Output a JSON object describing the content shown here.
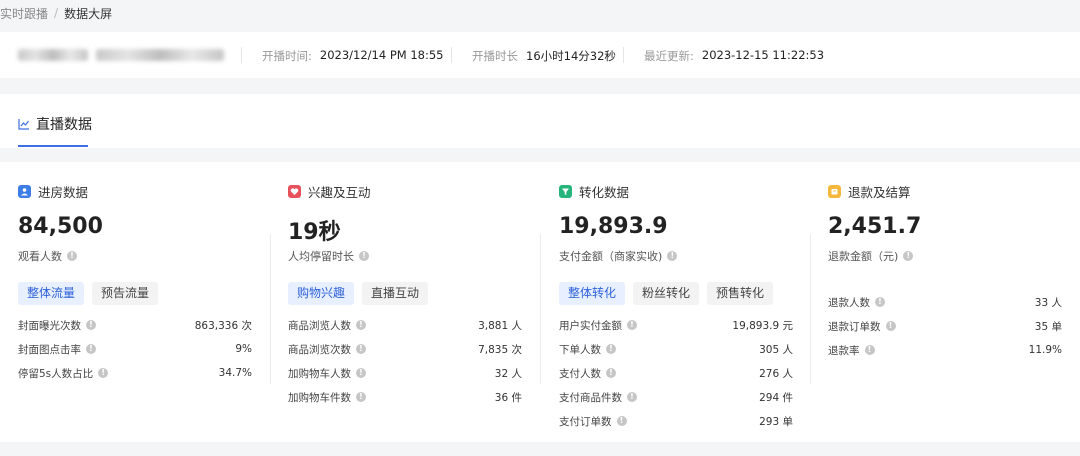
{
  "breadcrumb": {
    "parent": "实时跟播",
    "separator": "/",
    "current": "数据大屏"
  },
  "info": {
    "start_time_label": "开播时间:",
    "start_time_value": "2023/12/14 PM 18:55",
    "duration_label": "开播时长",
    "duration_value": "16小时14分32秒",
    "updated_label": "最近更新:",
    "updated_value": "2023-12-15 11:22:53"
  },
  "tab": {
    "label": "直播数据",
    "icon": "line-chart-icon"
  },
  "columns": [
    {
      "title": "进房数据",
      "icon": "user-icon",
      "icon_color": "#3c7de6",
      "metric_value": "84,500",
      "metric_label": "观看人数",
      "pills": [
        "整体流量",
        "预告流量"
      ],
      "rows": [
        {
          "label": "封面曝光次数",
          "value": "863,336 次"
        },
        {
          "label": "封面图点击率",
          "value": "9%"
        },
        {
          "label": "停留5s人数占比",
          "value": "34.7%"
        }
      ]
    },
    {
      "title": "兴趣及互动",
      "icon": "heart-icon",
      "icon_color": "#e8505b",
      "metric_value": "19秒",
      "metric_label": "人均停留时长",
      "pills": [
        "购物兴趣",
        "直播互动"
      ],
      "rows": [
        {
          "label": "商品浏览人数",
          "value": "3,881 人"
        },
        {
          "label": "商品浏览次数",
          "value": "7,835 次"
        },
        {
          "label": "加购物车人数",
          "value": "32 人"
        },
        {
          "label": "加购物车件数",
          "value": "36 件"
        }
      ]
    },
    {
      "title": "转化数据",
      "icon": "funnel-icon",
      "icon_color": "#26b47a",
      "metric_value": "19,893.9",
      "metric_label": "支付金额（商家实收)",
      "pills": [
        "整体转化",
        "粉丝转化",
        "预售转化"
      ],
      "rows": [
        {
          "label": "用户实付金额",
          "value": "19,893.9 元"
        },
        {
          "label": "下单人数",
          "value": "305 人"
        },
        {
          "label": "支付人数",
          "value": "276 人"
        },
        {
          "label": "支付商品件数",
          "value": "294 件"
        },
        {
          "label": "支付订单数",
          "value": "293 单"
        }
      ]
    },
    {
      "title": "退款及结算",
      "icon": "wallet-icon",
      "icon_color": "#f5b83d",
      "metric_value": "2,451.7",
      "metric_label": "退款金额（元)",
      "pills": [],
      "rows": [
        {
          "label": "退款人数",
          "value": "33 人"
        },
        {
          "label": "退款订单数",
          "value": "35 单"
        },
        {
          "label": "退款率",
          "value": "11.9%"
        }
      ]
    }
  ]
}
